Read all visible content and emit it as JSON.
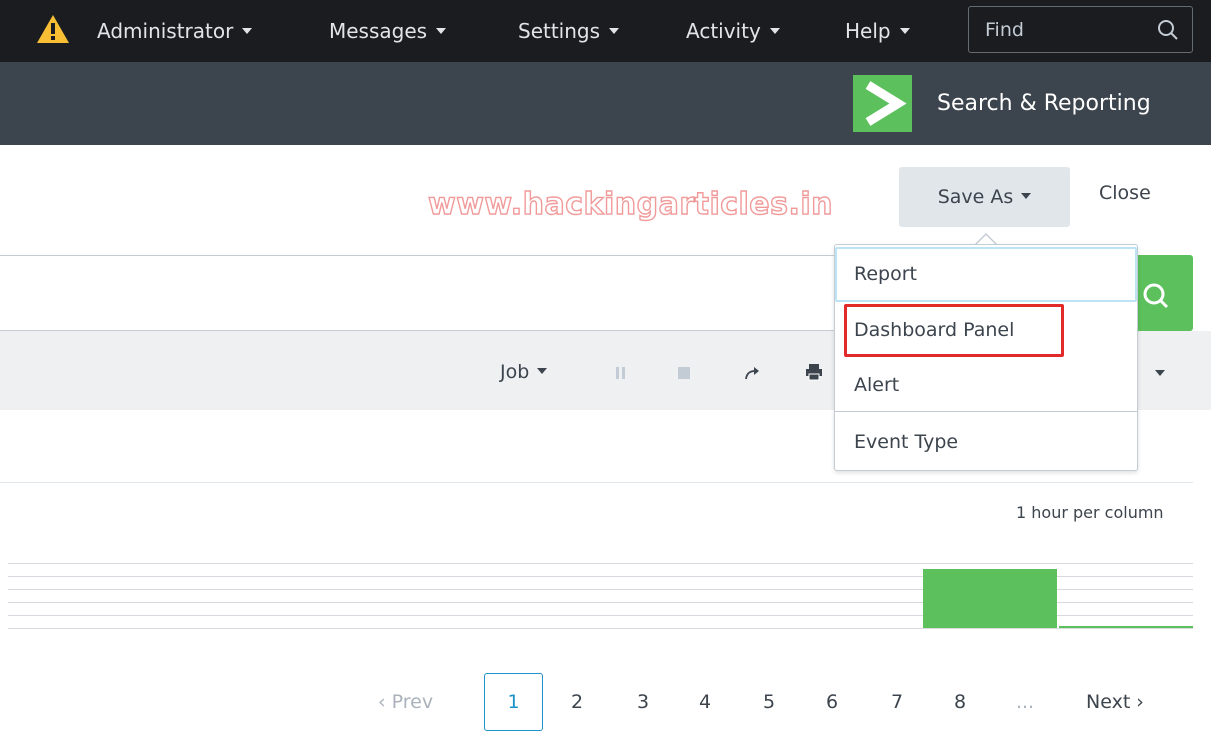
{
  "topnav": {
    "items": [
      {
        "label": "Administrator"
      },
      {
        "label": "Messages"
      },
      {
        "label": "Settings"
      },
      {
        "label": "Activity"
      },
      {
        "label": "Help"
      }
    ],
    "find_placeholder": "Find",
    "warning_icon": "warning-triangle-icon",
    "colors": {
      "background": "#1a1c20",
      "warning": "#f8be34"
    }
  },
  "appbar": {
    "app_name": "Search & Reporting",
    "logo_icon": "chevron-right-logo-icon",
    "colors": {
      "background": "#3c444d",
      "logo": "#5cc05c"
    }
  },
  "watermark": "www.hackingarticles.in",
  "actions": {
    "save_as": "Save As",
    "close": "Close"
  },
  "save_as_menu": {
    "items": [
      {
        "label": "Report"
      },
      {
        "label": "Dashboard Panel",
        "highlighted": true
      },
      {
        "label": "Alert"
      },
      {
        "label": "Event Type"
      }
    ]
  },
  "job_toolbar": {
    "job_label": "Job",
    "icons": [
      "pause-icon",
      "stop-icon",
      "share-icon",
      "print-icon"
    ]
  },
  "timeline": {
    "label": "1 hour per column",
    "bar_color": "#5cc05c"
  },
  "pagination": {
    "prev": "‹ Prev",
    "pages": [
      "1",
      "2",
      "3",
      "4",
      "5",
      "6",
      "7",
      "8"
    ],
    "current": "1",
    "ellipsis": "...",
    "next": "Next ›"
  }
}
